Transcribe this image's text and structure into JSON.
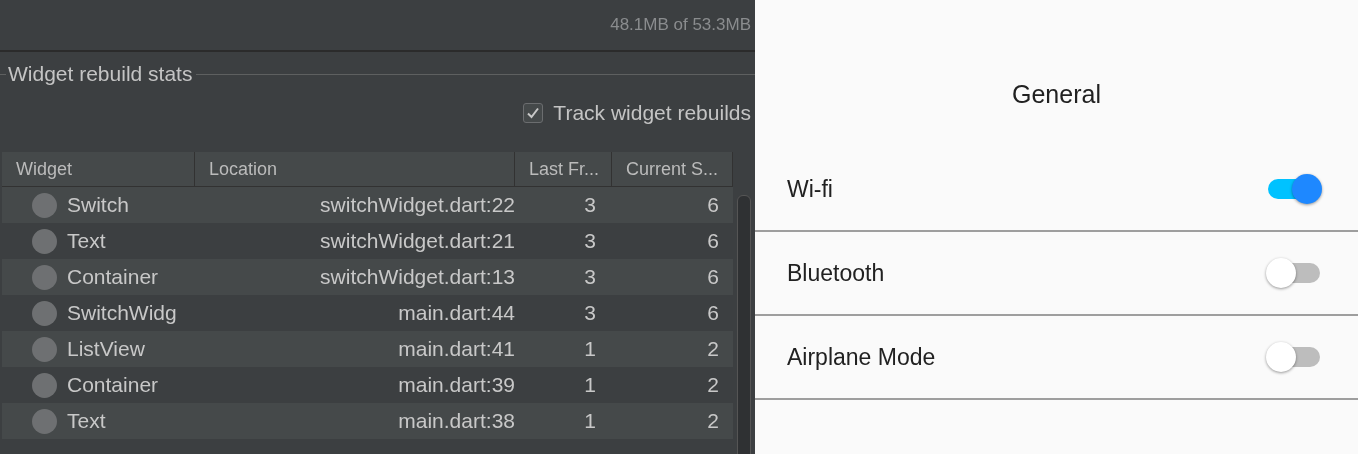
{
  "memory": "48.1MB of 53.3MB",
  "section": {
    "title": "Widget rebuild stats"
  },
  "track_checkbox": {
    "label": "Track widget rebuilds",
    "checked": true
  },
  "table": {
    "columns": [
      "Widget",
      "Location",
      "Last Fr...",
      "Current S..."
    ],
    "rows": [
      {
        "widget": "Switch",
        "location": "switchWidget.dart:22",
        "last": "3",
        "current": "6"
      },
      {
        "widget": "Text",
        "location": "switchWidget.dart:21",
        "last": "3",
        "current": "6"
      },
      {
        "widget": "Container",
        "location": "switchWidget.dart:13",
        "last": "3",
        "current": "6"
      },
      {
        "widget": "SwitchWidg",
        "location": "main.dart:44",
        "last": "3",
        "current": "6"
      },
      {
        "widget": "ListView",
        "location": "main.dart:41",
        "last": "1",
        "current": "2"
      },
      {
        "widget": "Container",
        "location": "main.dart:39",
        "last": "1",
        "current": "2"
      },
      {
        "widget": "Text",
        "location": "main.dart:38",
        "last": "1",
        "current": "2"
      }
    ]
  },
  "app": {
    "title": "General",
    "settings": [
      {
        "label": "Wi-fi",
        "on": true
      },
      {
        "label": "Bluetooth",
        "on": false
      },
      {
        "label": "Airplane Mode",
        "on": false
      }
    ]
  }
}
